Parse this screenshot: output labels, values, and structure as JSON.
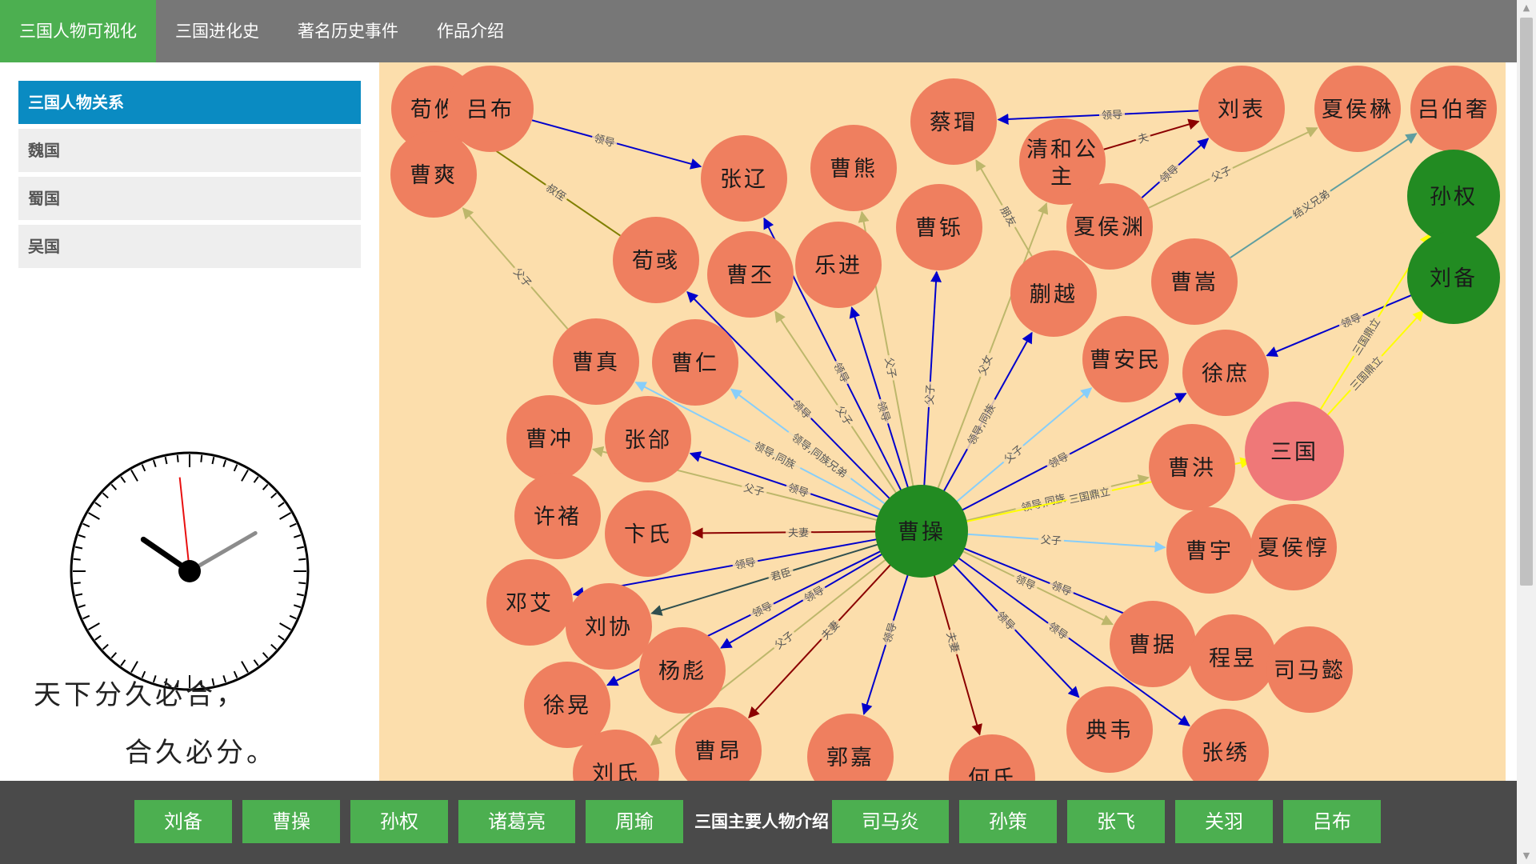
{
  "nav": {
    "items": [
      {
        "label": "三国人物可视化",
        "active": true
      },
      {
        "label": "三国进化史",
        "active": false
      },
      {
        "label": "著名历史事件",
        "active": false
      },
      {
        "label": "作品介绍",
        "active": false
      }
    ]
  },
  "sidebar": {
    "items": [
      {
        "label": "三国人物关系",
        "active": true
      },
      {
        "label": "魏国",
        "active": false
      },
      {
        "label": "蜀国",
        "active": false
      },
      {
        "label": "吴国",
        "active": false
      }
    ],
    "poem": {
      "line1": "天下分久必合，",
      "line2": "合久必分。"
    }
  },
  "clock": {
    "hours": 10,
    "minutes": 9,
    "seconds": 59
  },
  "graph": {
    "colors": {
      "node": "#ef7f5f",
      "center": "#228b22",
      "kingdom": "#ef7878",
      "background": "#fcdeac"
    },
    "nodes": [
      {
        "id": "曹操",
        "type": "center"
      },
      {
        "id": "荀攸"
      },
      {
        "id": "吕布"
      },
      {
        "id": "曹爽"
      },
      {
        "id": "张辽"
      },
      {
        "id": "曹熊"
      },
      {
        "id": "蔡瑁"
      },
      {
        "id": "清和公主"
      },
      {
        "id": "刘表"
      },
      {
        "id": "夏侯楙"
      },
      {
        "id": "吕伯奢"
      },
      {
        "id": "孙权",
        "type": "center"
      },
      {
        "id": "刘备",
        "type": "center"
      },
      {
        "id": "荀彧"
      },
      {
        "id": "曹丕"
      },
      {
        "id": "乐进"
      },
      {
        "id": "曹铄"
      },
      {
        "id": "夏侯渊"
      },
      {
        "id": "曹嵩"
      },
      {
        "id": "蒯越"
      },
      {
        "id": "曹真"
      },
      {
        "id": "曹仁"
      },
      {
        "id": "曹安民"
      },
      {
        "id": "徐庶"
      },
      {
        "id": "三国",
        "type": "kingdom"
      },
      {
        "id": "曹冲"
      },
      {
        "id": "张郃"
      },
      {
        "id": "曹洪"
      },
      {
        "id": "许褚"
      },
      {
        "id": "卞氏"
      },
      {
        "id": "曹宇"
      },
      {
        "id": "夏侯惇"
      },
      {
        "id": "邓艾"
      },
      {
        "id": "刘协"
      },
      {
        "id": "曹据"
      },
      {
        "id": "程昱"
      },
      {
        "id": "司马懿"
      },
      {
        "id": "杨彪"
      },
      {
        "id": "徐晃"
      },
      {
        "id": "典韦"
      },
      {
        "id": "曹昂"
      },
      {
        "id": "郭嘉"
      },
      {
        "id": "张绣"
      },
      {
        "id": "刘氏"
      },
      {
        "id": "何氏"
      }
    ],
    "edges": [
      {
        "from": "曹操",
        "to": "张辽",
        "label": "领导",
        "color": "#0000cc"
      },
      {
        "from": "曹操",
        "to": "曹熊",
        "label": "父子",
        "color": "#bdb76b"
      },
      {
        "from": "曹操",
        "to": "曹丕",
        "label": "父子",
        "color": "#bdb76b"
      },
      {
        "from": "曹操",
        "to": "乐进",
        "label": "领导",
        "color": "#0000cc"
      },
      {
        "from": "曹操",
        "to": "曹铄",
        "label": "父子",
        "color": "#0000cc"
      },
      {
        "from": "曹操",
        "to": "蒯越",
        "label": "领导,同族",
        "color": "#0000cc"
      },
      {
        "from": "曹操",
        "to": "清和公主",
        "label": "父女",
        "color": "#bdb76b"
      },
      {
        "from": "曹操",
        "to": "曹安民",
        "label": "父子",
        "color": "#87cefa"
      },
      {
        "from": "曹操",
        "to": "徐庶",
        "label": "领导",
        "color": "#0000cc"
      },
      {
        "from": "曹操",
        "to": "曹洪",
        "label": "领导,同族",
        "color": "#bdb76b"
      },
      {
        "from": "曹操",
        "to": "三国",
        "label": "三国鼎立",
        "color": "#ffff00"
      },
      {
        "from": "曹操",
        "to": "曹宇",
        "label": "父子",
        "color": "#87cefa"
      },
      {
        "from": "曹操",
        "to": "曹据",
        "label": "领导",
        "color": "#bdb76b"
      },
      {
        "from": "曹操",
        "to": "程昱",
        "label": "领导",
        "color": "#0000cc"
      },
      {
        "from": "曹操",
        "to": "典韦",
        "label": "领导",
        "color": "#0000cc"
      },
      {
        "from": "曹操",
        "to": "张绣",
        "label": "领导",
        "color": "#0000cc"
      },
      {
        "from": "曹操",
        "to": "荀彧",
        "label": "领导",
        "color": "#0000cc"
      },
      {
        "from": "曹操",
        "to": "曹真",
        "label": "领导,同族",
        "color": "#87cefa"
      },
      {
        "from": "曹操",
        "to": "曹仁",
        "label": "领导,同族兄弟",
        "color": "#87cefa"
      },
      {
        "from": "曹操",
        "to": "张郃",
        "label": "领导",
        "color": "#0000cc"
      },
      {
        "from": "曹操",
        "to": "曹冲",
        "label": "父子",
        "color": "#bdb76b"
      },
      {
        "from": "曹操",
        "to": "卞氏",
        "label": "夫妻",
        "color": "#8b0000"
      },
      {
        "from": "曹操",
        "to": "邓艾",
        "label": "领导",
        "color": "#0000cc"
      },
      {
        "from": "曹操",
        "to": "刘协",
        "label": "君臣",
        "color": "#2f4f4f"
      },
      {
        "from": "曹操",
        "to": "杨彪",
        "label": "领导",
        "color": "#0000cc"
      },
      {
        "from": "曹操",
        "to": "徐晃",
        "label": "领导",
        "color": "#0000cc"
      },
      {
        "from": "曹操",
        "to": "曹昂",
        "label": "夫妻",
        "color": "#8b0000"
      },
      {
        "from": "曹操",
        "to": "郭嘉",
        "label": "领导",
        "color": "#0000cc"
      },
      {
        "from": "曹操",
        "to": "刘氏",
        "label": "父子",
        "color": "#bdb76b"
      },
      {
        "from": "曹操",
        "to": "何氏",
        "label": "夫妻",
        "color": "#8b0000"
      },
      {
        "from": "吕布",
        "to": "张辽",
        "label": "领导",
        "color": "#0000cc"
      },
      {
        "from": "荀彧",
        "to": "荀攸",
        "label": "叔侄",
        "color": "#808000"
      },
      {
        "from": "曹真",
        "to": "曹爽",
        "label": "父子",
        "color": "#bdb76b"
      },
      {
        "from": "刘表",
        "to": "蔡瑁",
        "label": "领导",
        "color": "#0000cc"
      },
      {
        "from": "清和公主",
        "to": "刘表",
        "label": "夫",
        "color": "#8b0000"
      },
      {
        "from": "夏侯渊",
        "to": "刘表",
        "label": "领导",
        "color": "#0000cc"
      },
      {
        "from": "夏侯渊",
        "to": "夏侯楙",
        "label": "父子",
        "color": "#bdb76b"
      },
      {
        "from": "曹嵩",
        "to": "吕伯奢",
        "label": "结义兄弟",
        "color": "#5f9ea0"
      },
      {
        "from": "刘备",
        "to": "徐庶",
        "label": "领导",
        "color": "#0000cc"
      },
      {
        "from": "三国",
        "to": "刘备",
        "label": "三国鼎立",
        "color": "#ffff00"
      },
      {
        "from": "三国",
        "to": "孙权",
        "label": "三国鼎立",
        "color": "#ffff00"
      },
      {
        "from": "蒯越",
        "to": "蔡瑁",
        "label": "朋友",
        "color": "#bdb76b"
      }
    ]
  },
  "bottom": {
    "left_buttons": [
      "刘备",
      "曹操",
      "孙权",
      "诸葛亮",
      "周瑜"
    ],
    "title": "三国主要人物介绍",
    "right_buttons": [
      "司马炎",
      "孙策",
      "张飞",
      "关羽",
      "吕布"
    ]
  }
}
